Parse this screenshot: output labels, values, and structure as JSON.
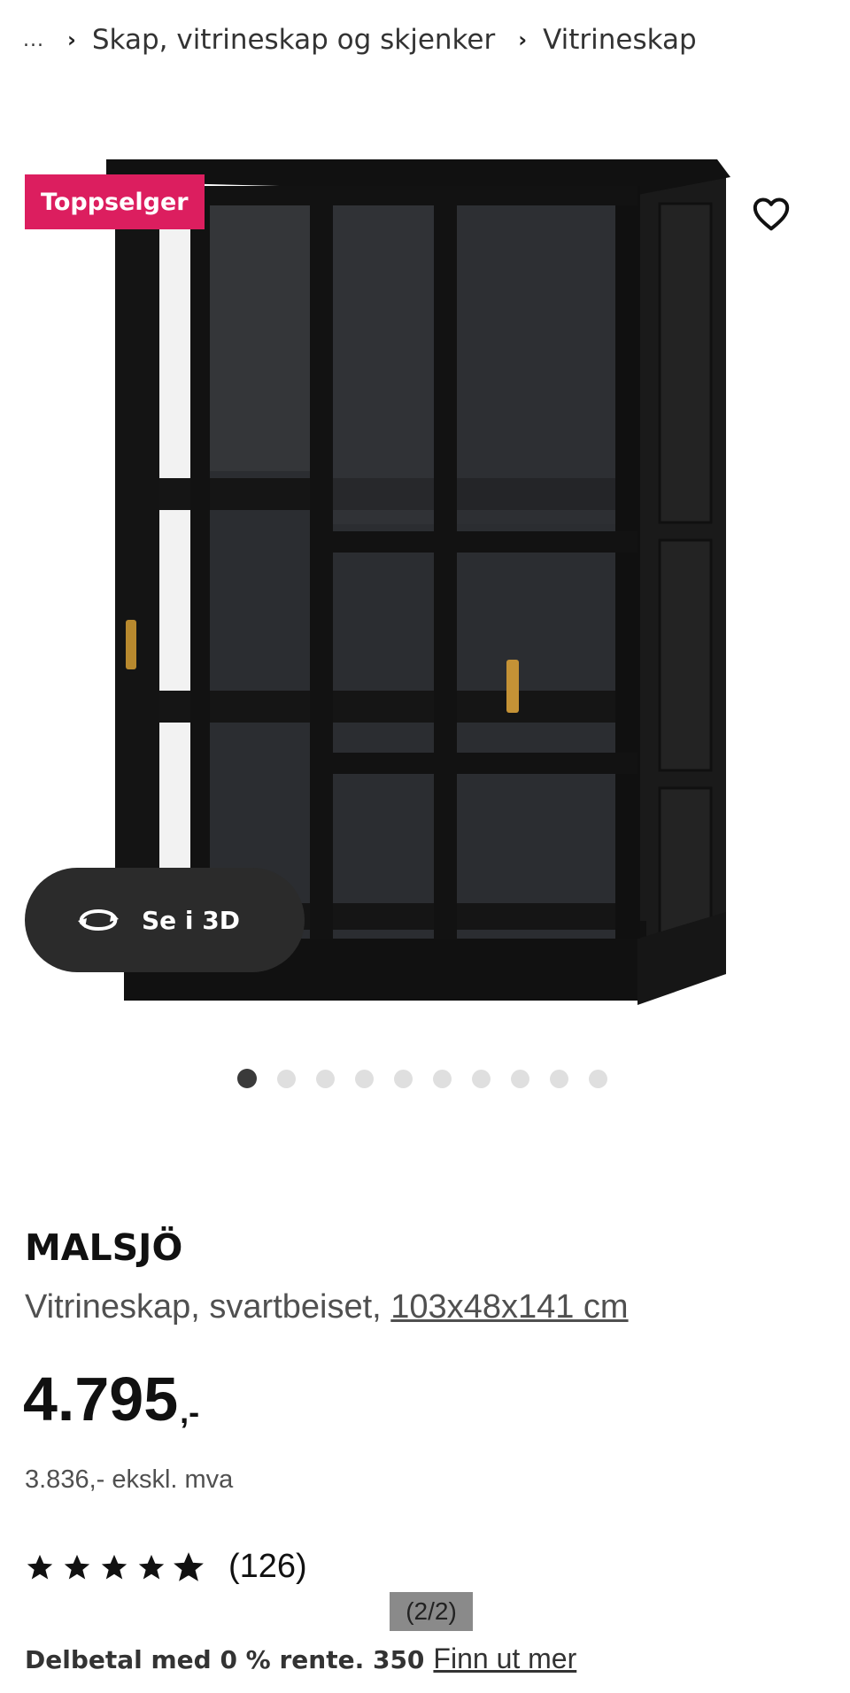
{
  "breadcrumb": {
    "ellipsis": "...",
    "items": [
      "Skap, vitrineskap og skjenker",
      "Vitrineskap"
    ]
  },
  "gallery": {
    "badge": "Toppselger",
    "view3d_label": "Se i 3D",
    "dot_count": 10,
    "active_dot": 1
  },
  "product": {
    "name": "MALSJÖ",
    "description": "Vitrineskap, svartbeiset,",
    "dimensions": "103x48x141 cm",
    "price": "4.795",
    "price_suffix": ",-",
    "price_ex_vat": "3.836,- ekskl. mva",
    "rating_stars": 4.5,
    "review_count": "(126)"
  },
  "overlay": {
    "pager": "(2/2)"
  },
  "installment": {
    "text": "Delbetal med 0 % rente. 350",
    "link": "Finn ut mer"
  },
  "colors": {
    "badge": "#dc1e5f",
    "view3d_bg": "#2b2b2b"
  }
}
